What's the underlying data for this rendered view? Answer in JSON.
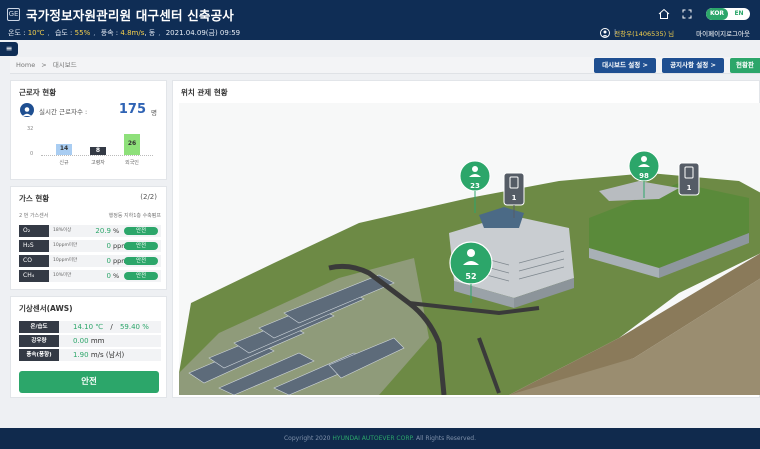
{
  "header": {
    "logo": "GE",
    "title": "국가정보자원관리원 대구센터 신축공사",
    "weather": {
      "temp_label": "온도 :",
      "temp_value": "10℃",
      "humidity_label": "습도 :",
      "humidity_value": "55%",
      "wind_label": "풍속 :",
      "wind_value": "4.8m/s",
      "wind_dir": ", 동",
      "datetime": "2021.04.09(금) 09:59"
    },
    "lang": [
      "KOR",
      "EN"
    ],
    "user": {
      "name": "전창우(1406535) 님",
      "mypage": "마이페이지",
      "logout": "로그아웃"
    }
  },
  "sidebar_toggle": "≡",
  "breadcrumb": {
    "home": "Home",
    "sep": ">",
    "current": "대시보드"
  },
  "buttons": {
    "dashboard_settings": "대시보드 설정 >",
    "notice_settings": "공지사항 설정 >",
    "management": "현황판"
  },
  "workers": {
    "title": "근로자 현황",
    "realtime_label": "실시간 근로자수 :",
    "count": "175",
    "unit": "명",
    "axis_max": "32",
    "axis_min": "0",
    "chart_data": {
      "type": "bar",
      "categories": [
        "신규",
        "고령자",
        "외국인"
      ],
      "values": [
        14,
        8,
        26
      ],
      "ylim": [
        0,
        32
      ],
      "colors": [
        "#a9cdf2",
        "#343a45",
        "#8ee07a"
      ]
    }
  },
  "gas": {
    "title": "가스 현황",
    "page": "(2/2)",
    "sensor_label": "2 번 가스센서",
    "criteria_label": "행정등 지하1층 수축펌프",
    "rows": [
      {
        "name": "O₂",
        "standard": "18%이상",
        "value": "20.9",
        "unit": "%",
        "status": "안전"
      },
      {
        "name": "H₂S",
        "standard": "10ppm미만",
        "value": "0",
        "unit": "ppm",
        "status": "안전"
      },
      {
        "name": "CO",
        "standard": "10ppm미만",
        "value": "0",
        "unit": "ppm",
        "status": "안전"
      },
      {
        "name": "CH₄",
        "standard": "10%미만",
        "value": "0",
        "unit": "%",
        "status": "안전"
      }
    ]
  },
  "aws": {
    "title": "기상센서(AWS)",
    "rows": [
      {
        "name": "온/습도",
        "value": "14.10 ℃",
        "sep": "/",
        "value2": "59.40 %"
      },
      {
        "name": "강우량",
        "value": "0.00",
        "unit": "mm"
      },
      {
        "name": "풍속(풍향)",
        "value": "1.90",
        "unit": "m/s (남서)"
      }
    ],
    "status_button": "안전"
  },
  "map": {
    "title": "위치 관제 현황",
    "pins": [
      {
        "type": "worker",
        "count": "23"
      },
      {
        "type": "device",
        "count": "1"
      },
      {
        "type": "worker",
        "count": "98"
      },
      {
        "type": "device",
        "count": "1"
      },
      {
        "type": "worker",
        "count": "52"
      }
    ]
  },
  "footer": {
    "prefix": "Copyright 2020",
    "brand": "HYUNDAI AUTOEVER CORP.",
    "suffix": "All Rights Reserved."
  }
}
